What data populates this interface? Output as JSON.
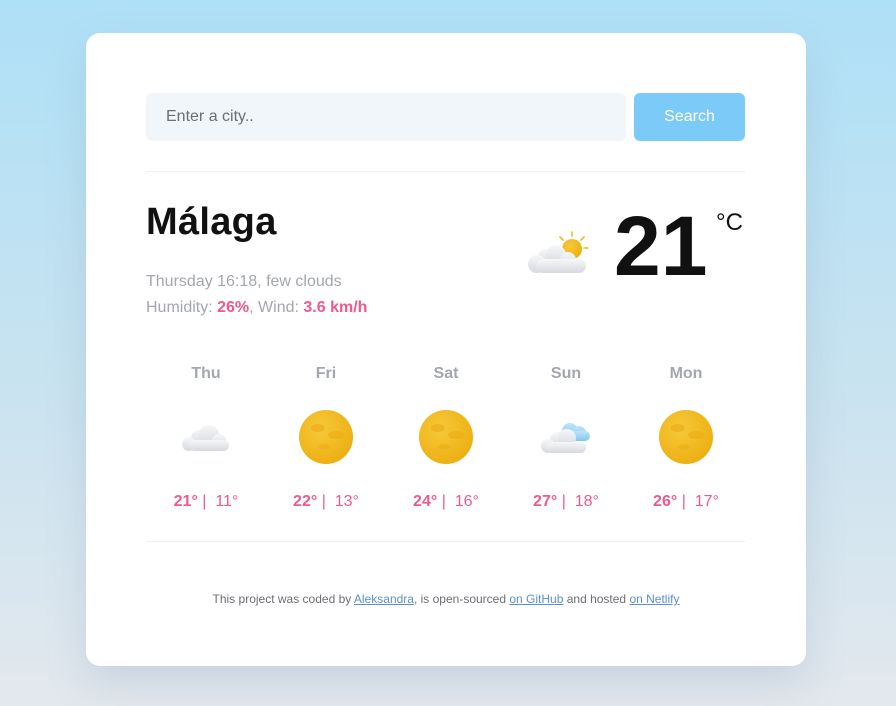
{
  "search": {
    "placeholder": "Enter a city..",
    "value": "",
    "button_label": "Search"
  },
  "current": {
    "city": "Málaga",
    "datetime_description": "Thursday 16:18, few clouds",
    "humidity_label": "Humidity: ",
    "humidity_value": "26%",
    "wind_label": ", Wind: ",
    "wind_value": "3.6 km/h",
    "temperature": "21",
    "unit": "°C",
    "icon": "few-clouds-icon"
  },
  "forecast": [
    {
      "day": "Thu",
      "icon": "cloud-icon",
      "max": "21°",
      "separator": " |  ",
      "min": "11°"
    },
    {
      "day": "Fri",
      "icon": "sun-icon",
      "max": "22°",
      "separator": " |  ",
      "min": "13°"
    },
    {
      "day": "Sat",
      "icon": "sun-icon",
      "max": "24°",
      "separator": " |  ",
      "min": "16°"
    },
    {
      "day": "Sun",
      "icon": "clouds-icon",
      "max": "27°",
      "separator": " |  ",
      "min": "18°"
    },
    {
      "day": "Mon",
      "icon": "sun-icon",
      "max": "26°",
      "separator": " |  ",
      "min": "17°"
    }
  ],
  "footer": {
    "text1": "This project was coded by ",
    "link1": "Aleksandra",
    "text2": ", is open-sourced ",
    "link2": "on GitHub",
    "text3": " and hosted ",
    "link3": "on Netlify"
  },
  "colors": {
    "accent_pink": "#ee5a8c",
    "button_blue": "#7ccaf8",
    "muted_text": "#a3a7ad",
    "sun_yellow": "#f2b81a"
  }
}
